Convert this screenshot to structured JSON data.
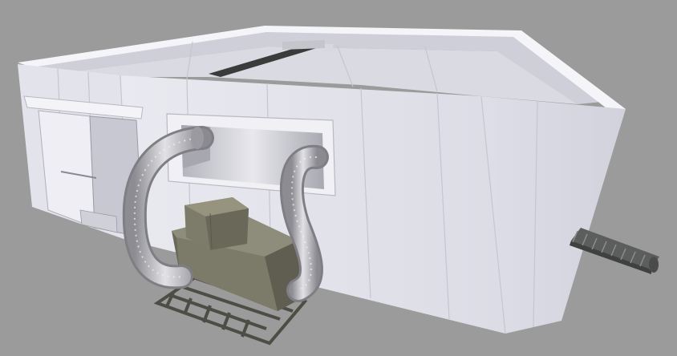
{
  "scene": {
    "subject": "insulated-cold-room-render",
    "colors": {
      "background": "#9a9a9a",
      "wall_front": "#e6e6ee",
      "wall_side": "#d8d8e2",
      "wall_inner": "#c9c9d4",
      "top_edge": "#f3f3f8",
      "unit_body": "#777565",
      "unit_dark": "#5f5d50",
      "duct": "#c4c4c8",
      "grate": "#4a4a44",
      "conveyor": "#6f7170"
    },
    "objects": [
      "cold-room-enclosure",
      "sliding-door",
      "duct-opening-panel",
      "flexible-duct-left",
      "flexible-duct-right",
      "refrigeration-unit",
      "floor-grate",
      "conveyor-belt",
      "ceiling-rail"
    ]
  }
}
